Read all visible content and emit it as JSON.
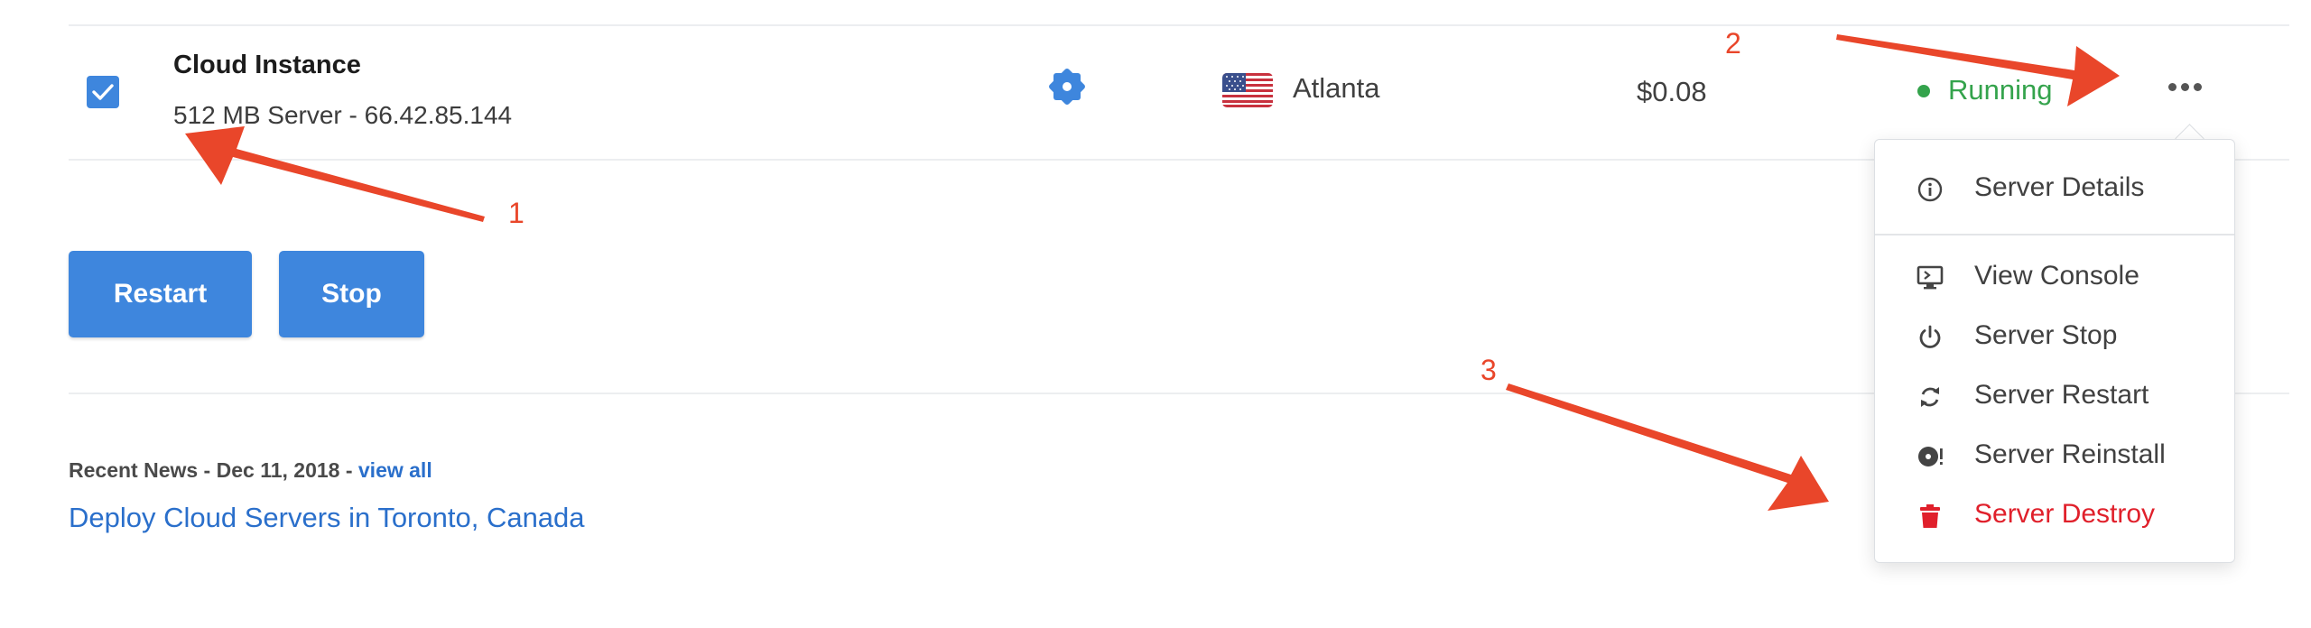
{
  "server": {
    "name": "Cloud Instance",
    "details": "512 MB Server - 66.42.85.144",
    "location": "Atlanta",
    "price": "$0.08",
    "status": "Running",
    "selected": true
  },
  "actions": {
    "restart_label": "Restart",
    "stop_label": "Stop"
  },
  "news": {
    "prefix": "Recent News - Dec 11, 2018 - ",
    "view_all": "view all",
    "headline": "Deploy Cloud Servers in Toronto, Canada"
  },
  "menu": {
    "items": [
      {
        "label": "Server Details",
        "icon": "info-circle-icon"
      },
      {
        "label": "View Console",
        "icon": "monitor-console-icon"
      },
      {
        "label": "Server Stop",
        "icon": "power-icon"
      },
      {
        "label": "Server Restart",
        "icon": "refresh-icon"
      },
      {
        "label": "Server Reinstall",
        "icon": "disc-reinstall-icon"
      },
      {
        "label": "Server Destroy",
        "icon": "trash-icon"
      }
    ]
  },
  "annotations": [
    "1",
    "2",
    "3"
  ],
  "colors": {
    "accent": "#3e86dd",
    "running": "#34a34c",
    "link": "#2a6fcb",
    "danger": "#e0202b",
    "annotation": "#e9462a"
  }
}
